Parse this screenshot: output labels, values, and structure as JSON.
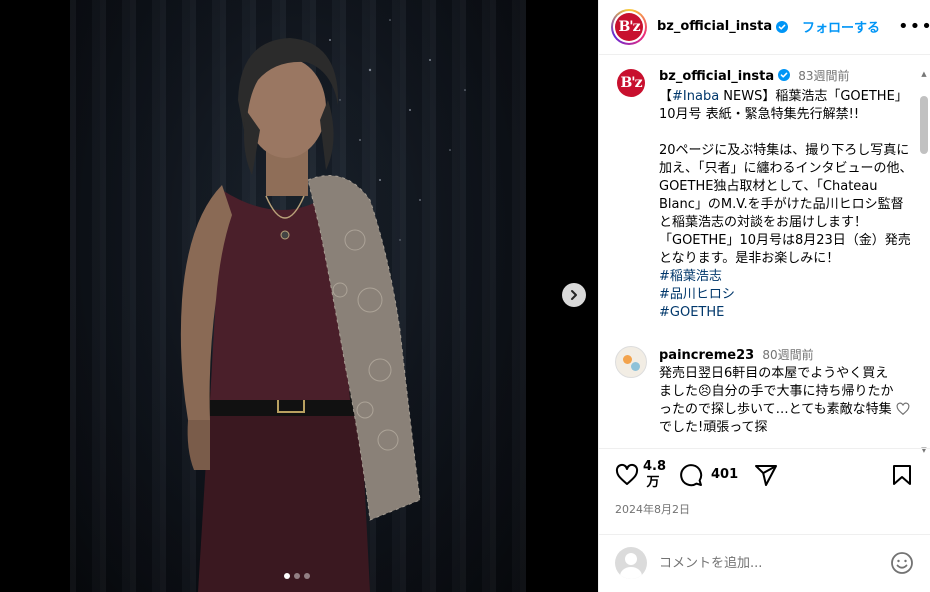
{
  "post": {
    "username": "bz_official_insta",
    "logo_text": "B'z",
    "follow_label": "フォローする",
    "more_label": "•••"
  },
  "caption": {
    "username": "bz_official_insta",
    "time": "83週間前",
    "tag_inline": "#Inaba",
    "text": " NEWS】稲葉浩志「GOETHE」10月号 表紙・緊急特集先行解禁!!\n\n20ページに及ぶ特集は、撮り下ろし写真に加え、「只者」に纏わるインタビューの他、GOETHE独占取材として、「Chateau Blanc」のM.V.を手がけた品川ヒロシ監督と稲葉浩志の対談をお届けします！\n「GOETHE」10月号は8月23日（金）発売となります。是非お楽しみに！\n",
    "prefix": "【",
    "hashtags": [
      "#稲葉浩志",
      "#品川ヒロシ",
      "#GOETHE"
    ]
  },
  "comment": {
    "username": "paincreme23",
    "time": "80週間前",
    "text": "発売日翌日6軒目の本屋でようやく買えました😣自分の手で大事に持ち帰りたかったので探し歩いて…とても素敵な特集でした!頑張って探"
  },
  "actions": {
    "likes_top": "4.8",
    "likes_bottom": "万",
    "comments_count": "401",
    "date": "2024年8月2日"
  },
  "add_comment": {
    "placeholder": "コメントを追加..."
  },
  "carousel": {
    "count": 3,
    "active": 0
  },
  "colors": {
    "accent": "#0095f6",
    "brand": "#c8102e",
    "hashtag": "#00376b"
  },
  "icons": [
    "verified-badge-icon",
    "chevron-right-icon",
    "heart-icon",
    "comment-icon",
    "share-icon",
    "bookmark-icon",
    "emoji-icon"
  ]
}
